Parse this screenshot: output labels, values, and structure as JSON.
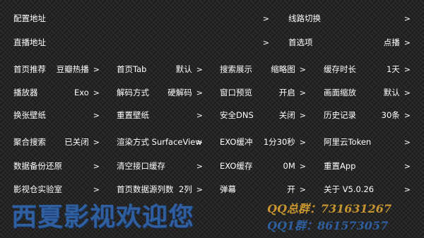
{
  "row1": [
    {
      "label": "配置地址",
      "value": ""
    },
    {
      "label": "线路切换",
      "value": ""
    }
  ],
  "row2": [
    {
      "label": "直播地址",
      "value": ""
    },
    {
      "label": "首选项",
      "value": "点播"
    }
  ],
  "row3": [
    {
      "label": "首页推荐",
      "value": "豆瓣热播"
    },
    {
      "label": "首页Tab",
      "value": "默认"
    },
    {
      "label": "搜索展示",
      "value": "缩略图"
    },
    {
      "label": "缓存时长",
      "value": "1天"
    }
  ],
  "row4": [
    {
      "label": "播放器",
      "value": "Exo"
    },
    {
      "label": "解码方式",
      "value": "硬解码"
    },
    {
      "label": "窗口预览",
      "value": "开启"
    },
    {
      "label": "画面缩放",
      "value": "默认"
    }
  ],
  "row5": [
    {
      "label": "换张壁纸",
      "value": ""
    },
    {
      "label": "重置壁纸",
      "value": ""
    },
    {
      "label": "安全DNS",
      "value": "关闭"
    },
    {
      "label": "历史记录",
      "value": "30条"
    }
  ],
  "row6": [
    {
      "label": "聚合搜索",
      "value": "已关闭"
    },
    {
      "label": "渲染方式 SurfaceView",
      "value": ""
    },
    {
      "label": "EXO缓冲",
      "value": "1分30秒"
    },
    {
      "label": "阿里云Token",
      "value": ""
    }
  ],
  "row7": [
    {
      "label": "数据备份还原",
      "value": ""
    },
    {
      "label": "清空接口缓存",
      "value": ""
    },
    {
      "label": "EXO缓存",
      "value": "0M"
    },
    {
      "label": "重置App",
      "value": ""
    }
  ],
  "row8": [
    {
      "label": "影视仓实验室",
      "value": ""
    },
    {
      "label": "首页数据源列数",
      "value": "2列"
    },
    {
      "label": "弹幕",
      "value": "开"
    },
    {
      "label": "关于  V5.0.26",
      "value": ""
    }
  ],
  "chevron": ">",
  "watermark": {
    "title": "西夏影视欢迎您",
    "qq1": "QQ总群：731631267",
    "qq2": "QQ1群：861573057"
  }
}
